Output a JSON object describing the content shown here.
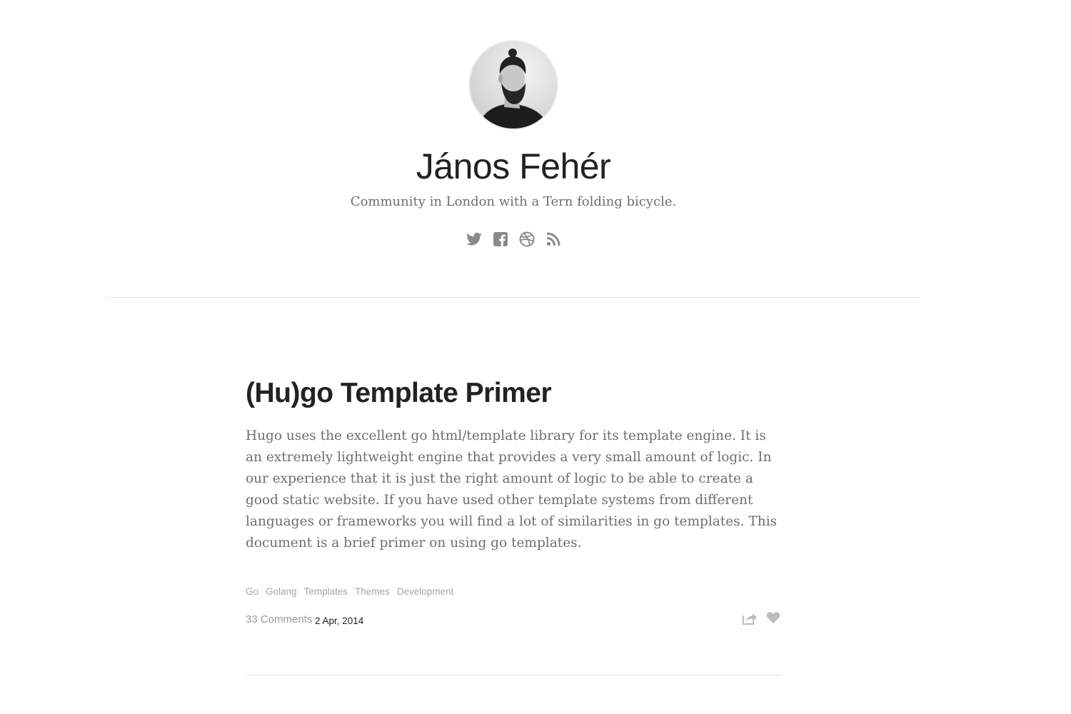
{
  "header": {
    "title": "János Fehér",
    "description": "Community in London with a Tern folding bicycle.",
    "social_icons": [
      "twitter-icon",
      "facebook-icon",
      "dribbble-icon",
      "rss-icon"
    ]
  },
  "post": {
    "title": "(Hu)go Template Primer",
    "excerpt": "Hugo uses the excellent go html/template library for its template engine. It is an extremely lightweight engine that provides a very small amount of logic. In our experience that it is just the right amount of logic to be able to create a good static website. If you have used other template systems from different languages or frameworks you will find a lot of similarities in go templates. This document is a brief primer on using go templates.",
    "tags": [
      "Go",
      "Golang",
      "Templates",
      "Themes",
      "Development"
    ],
    "comments": "33 Comments",
    "date": "2 Apr, 2014"
  },
  "colors": {
    "icon_gray": "#8a8a8a",
    "muted_text": "#6e6e6e",
    "tag_gray": "#a6a6a6",
    "divider": "#e5e5e5"
  }
}
